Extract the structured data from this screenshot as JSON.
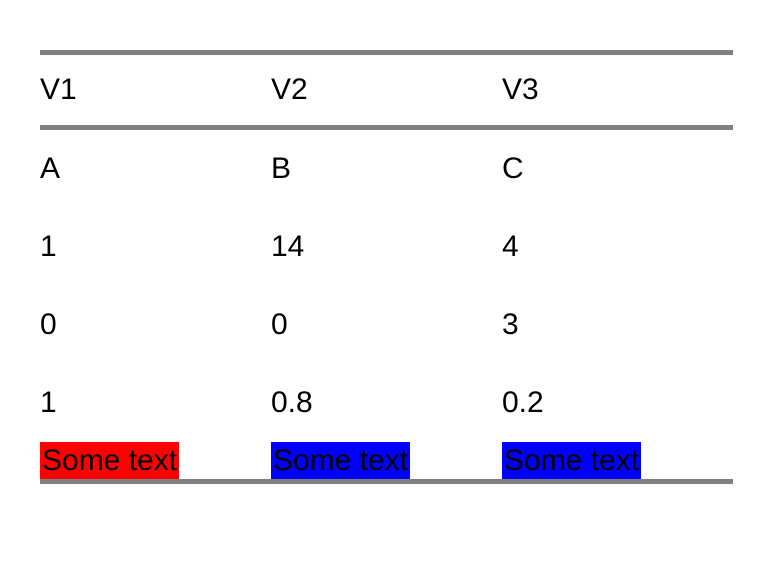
{
  "table": {
    "headers": [
      "V1",
      "V2",
      "V3"
    ],
    "rows": [
      [
        "A",
        "B",
        "C"
      ],
      [
        "1",
        "14",
        "4"
      ],
      [
        "0",
        "0",
        "3"
      ],
      [
        "1",
        "0.8",
        "0.2"
      ]
    ],
    "highlighted_row": {
      "cells": [
        "Some text",
        "Some text",
        "Some text"
      ],
      "colors": [
        "#ff0000",
        "#0000ff",
        "#0000ff"
      ]
    }
  }
}
